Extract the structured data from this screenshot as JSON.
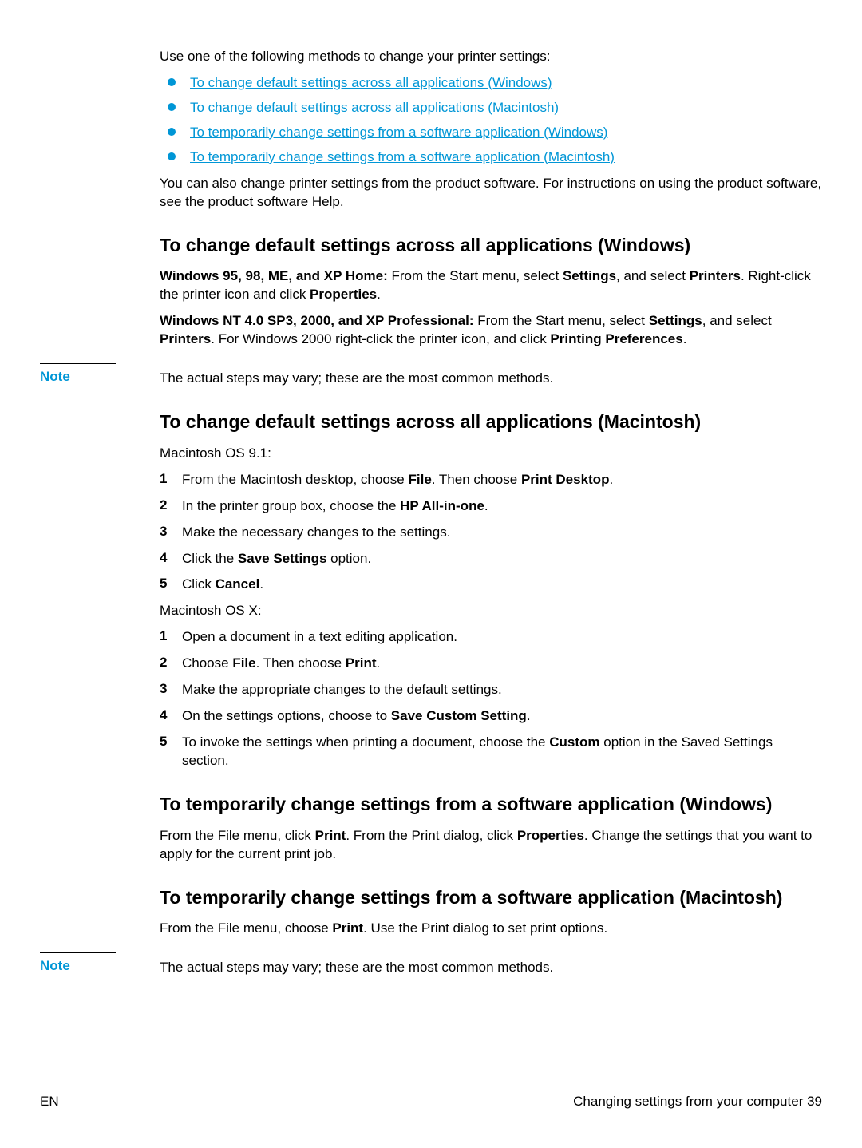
{
  "intro": "Use one of the following methods to change your printer settings:",
  "bullets": [
    "To change default settings across all applications (Windows)",
    "To change default settings across all applications (Macintosh)",
    "To temporarily change settings from a software application (Windows)",
    "To temporarily change settings from a software application (Macintosh)"
  ],
  "post_bullets": "You can also change printer settings from the product software. For instructions on using the product software, see the product software Help.",
  "sec_win_default": {
    "heading": "To change default settings across all applications (Windows)",
    "p1_lead": "Windows 95, 98, ME, and XP Home: ",
    "p1_rest_a": "From the Start menu, select ",
    "p1_b1": "Settings",
    "p1_rest_b": ", and select ",
    "p1_b2": "Printers",
    "p1_rest_c": ". Right-click the printer icon and click ",
    "p1_b3": "Properties",
    "p1_rest_d": ".",
    "p2_lead": "Windows NT 4.0 SP3, 2000, and XP Professional: ",
    "p2_rest_a": "From the Start menu, select ",
    "p2_b1": "Settings",
    "p2_rest_b": ", and select ",
    "p2_b2": "Printers",
    "p2_rest_c": ". For Windows 2000 right-click the printer icon, and click ",
    "p2_b3": "Printing Preferences",
    "p2_rest_d": "."
  },
  "note1": {
    "label": "Note",
    "text": "The actual steps may vary; these are the most common methods."
  },
  "sec_mac_default": {
    "heading": "To change default settings across all applications (Macintosh)",
    "sub1": "Macintosh OS 9.1:",
    "steps1": {
      "s1_a": "From the Macintosh desktop, choose ",
      "s1_b1": "File",
      "s1_b": ". Then choose ",
      "s1_b2": "Print Desktop",
      "s1_c": ".",
      "s2_a": "In the printer group box, choose the ",
      "s2_b1": "HP All-in-one",
      "s2_b": ".",
      "s3": "Make the necessary changes to the settings.",
      "s4_a": "Click the ",
      "s4_b1": "Save Settings",
      "s4_b": " option.",
      "s5_a": "Click ",
      "s5_b1": "Cancel",
      "s5_b": "."
    },
    "sub2": "Macintosh OS X:",
    "steps2": {
      "s1": "Open a document in a text editing application.",
      "s2_a": "Choose ",
      "s2_b1": "File",
      "s2_b": ". Then choose ",
      "s2_b2": "Print",
      "s2_c": ".",
      "s3": "Make the appropriate changes to the default settings.",
      "s4_a": "On the settings options, choose to ",
      "s4_b1": "Save Custom Setting",
      "s4_b": ".",
      "s5_a": "To invoke the settings when printing a document, choose the ",
      "s5_b1": "Custom",
      "s5_b": " option in the Saved Settings section."
    }
  },
  "sec_win_temp": {
    "heading": "To temporarily change settings from a software application (Windows)",
    "p_a": "From the File menu, click ",
    "p_b1": "Print",
    "p_b": ". From the Print dialog, click ",
    "p_b2": "Properties",
    "p_c": ". Change the settings that you want to apply for the current print job."
  },
  "sec_mac_temp": {
    "heading": "To temporarily change settings from a software application (Macintosh)",
    "p_a": "From the File menu, choose ",
    "p_b1": "Print",
    "p_b": ". Use the Print dialog to set print options."
  },
  "note2": {
    "label": "Note",
    "text": "The actual steps may vary; these are the most common methods."
  },
  "footer": {
    "left": "EN",
    "right_text": "Changing settings from your computer ",
    "page": "39"
  },
  "nums": {
    "n1": "1",
    "n2": "2",
    "n3": "3",
    "n4": "4",
    "n5": "5"
  }
}
